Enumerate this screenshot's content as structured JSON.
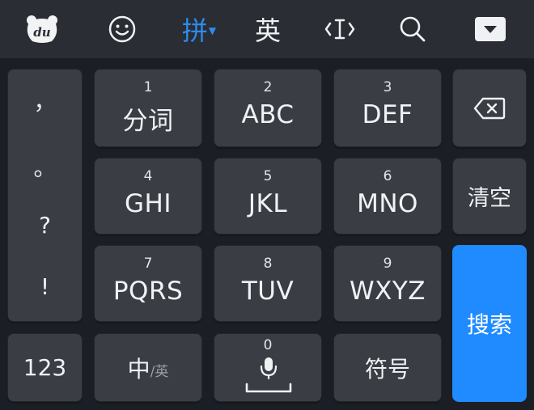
{
  "toolbar": {
    "logo_text": "du",
    "emoji_icon": "smiley-face-icon",
    "pinyin_label": "拼",
    "english_label": "英",
    "cursor_icon": "text-cursor-icon",
    "search_icon": "search-icon",
    "collapse_icon": "collapse-keyboard-icon",
    "active_color": "#2d8cf0"
  },
  "punctuation": [
    "，",
    "。",
    "?",
    "!"
  ],
  "keys": {
    "k1": {
      "num": "1",
      "label": "分词"
    },
    "k2": {
      "num": "2",
      "label": "ABC"
    },
    "k3": {
      "num": "3",
      "label": "DEF"
    },
    "k4": {
      "num": "4",
      "label": "GHI"
    },
    "k5": {
      "num": "5",
      "label": "JKL"
    },
    "k6": {
      "num": "6",
      "label": "MNO"
    },
    "k7": {
      "num": "7",
      "label": "PQRS"
    },
    "k8": {
      "num": "8",
      "label": "TUV"
    },
    "k9": {
      "num": "9",
      "label": "WXYZ"
    }
  },
  "right": {
    "backspace_icon": "backspace-icon",
    "clear_label": "清空",
    "search_label": "搜索",
    "search_color": "#1f8bff"
  },
  "bottom": {
    "numbers_label": "123",
    "lang_main": "中",
    "lang_alt": "/英",
    "space_num": "0",
    "mic_icon": "microphone-icon",
    "symbols_label": "符号"
  }
}
